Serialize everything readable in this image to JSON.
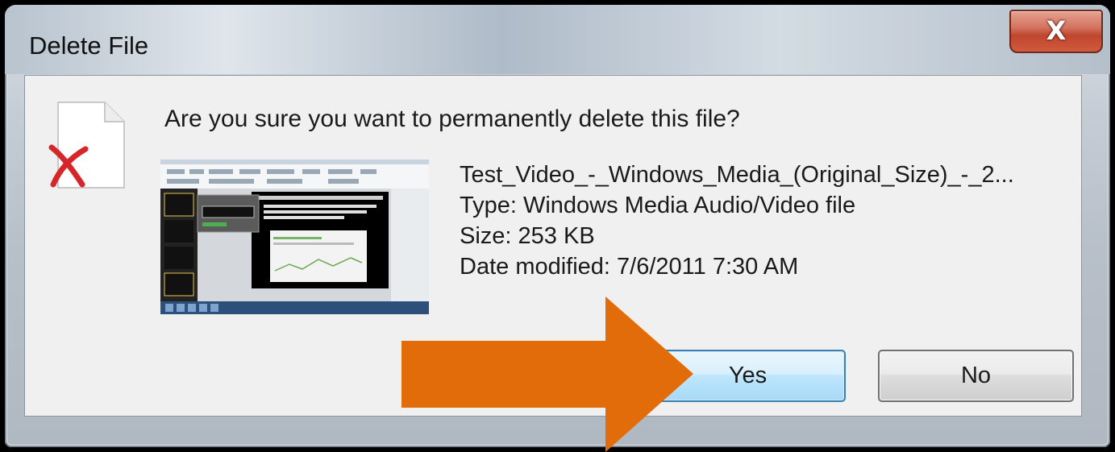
{
  "window": {
    "title": "Delete File",
    "close_glyph": "X"
  },
  "dialog": {
    "question": "Are you sure you want to permanently delete this file?",
    "icon": "deleted-file-icon",
    "file": {
      "name": "Test_Video_-_Windows_Media_(Original_Size)_-_2...",
      "type": "Type: Windows Media Audio/Video file",
      "size": "Size: 253 KB",
      "date_modified": "Date modified: 7/6/2011 7:30 AM"
    },
    "buttons": {
      "yes_label": "Yes",
      "no_label": "No"
    }
  },
  "annotation": {
    "arrow_color": "#E36C0A",
    "points_to": "Yes"
  },
  "colors": {
    "yes_button_border": "#3C7FB1",
    "close_button": "#C0472F"
  }
}
